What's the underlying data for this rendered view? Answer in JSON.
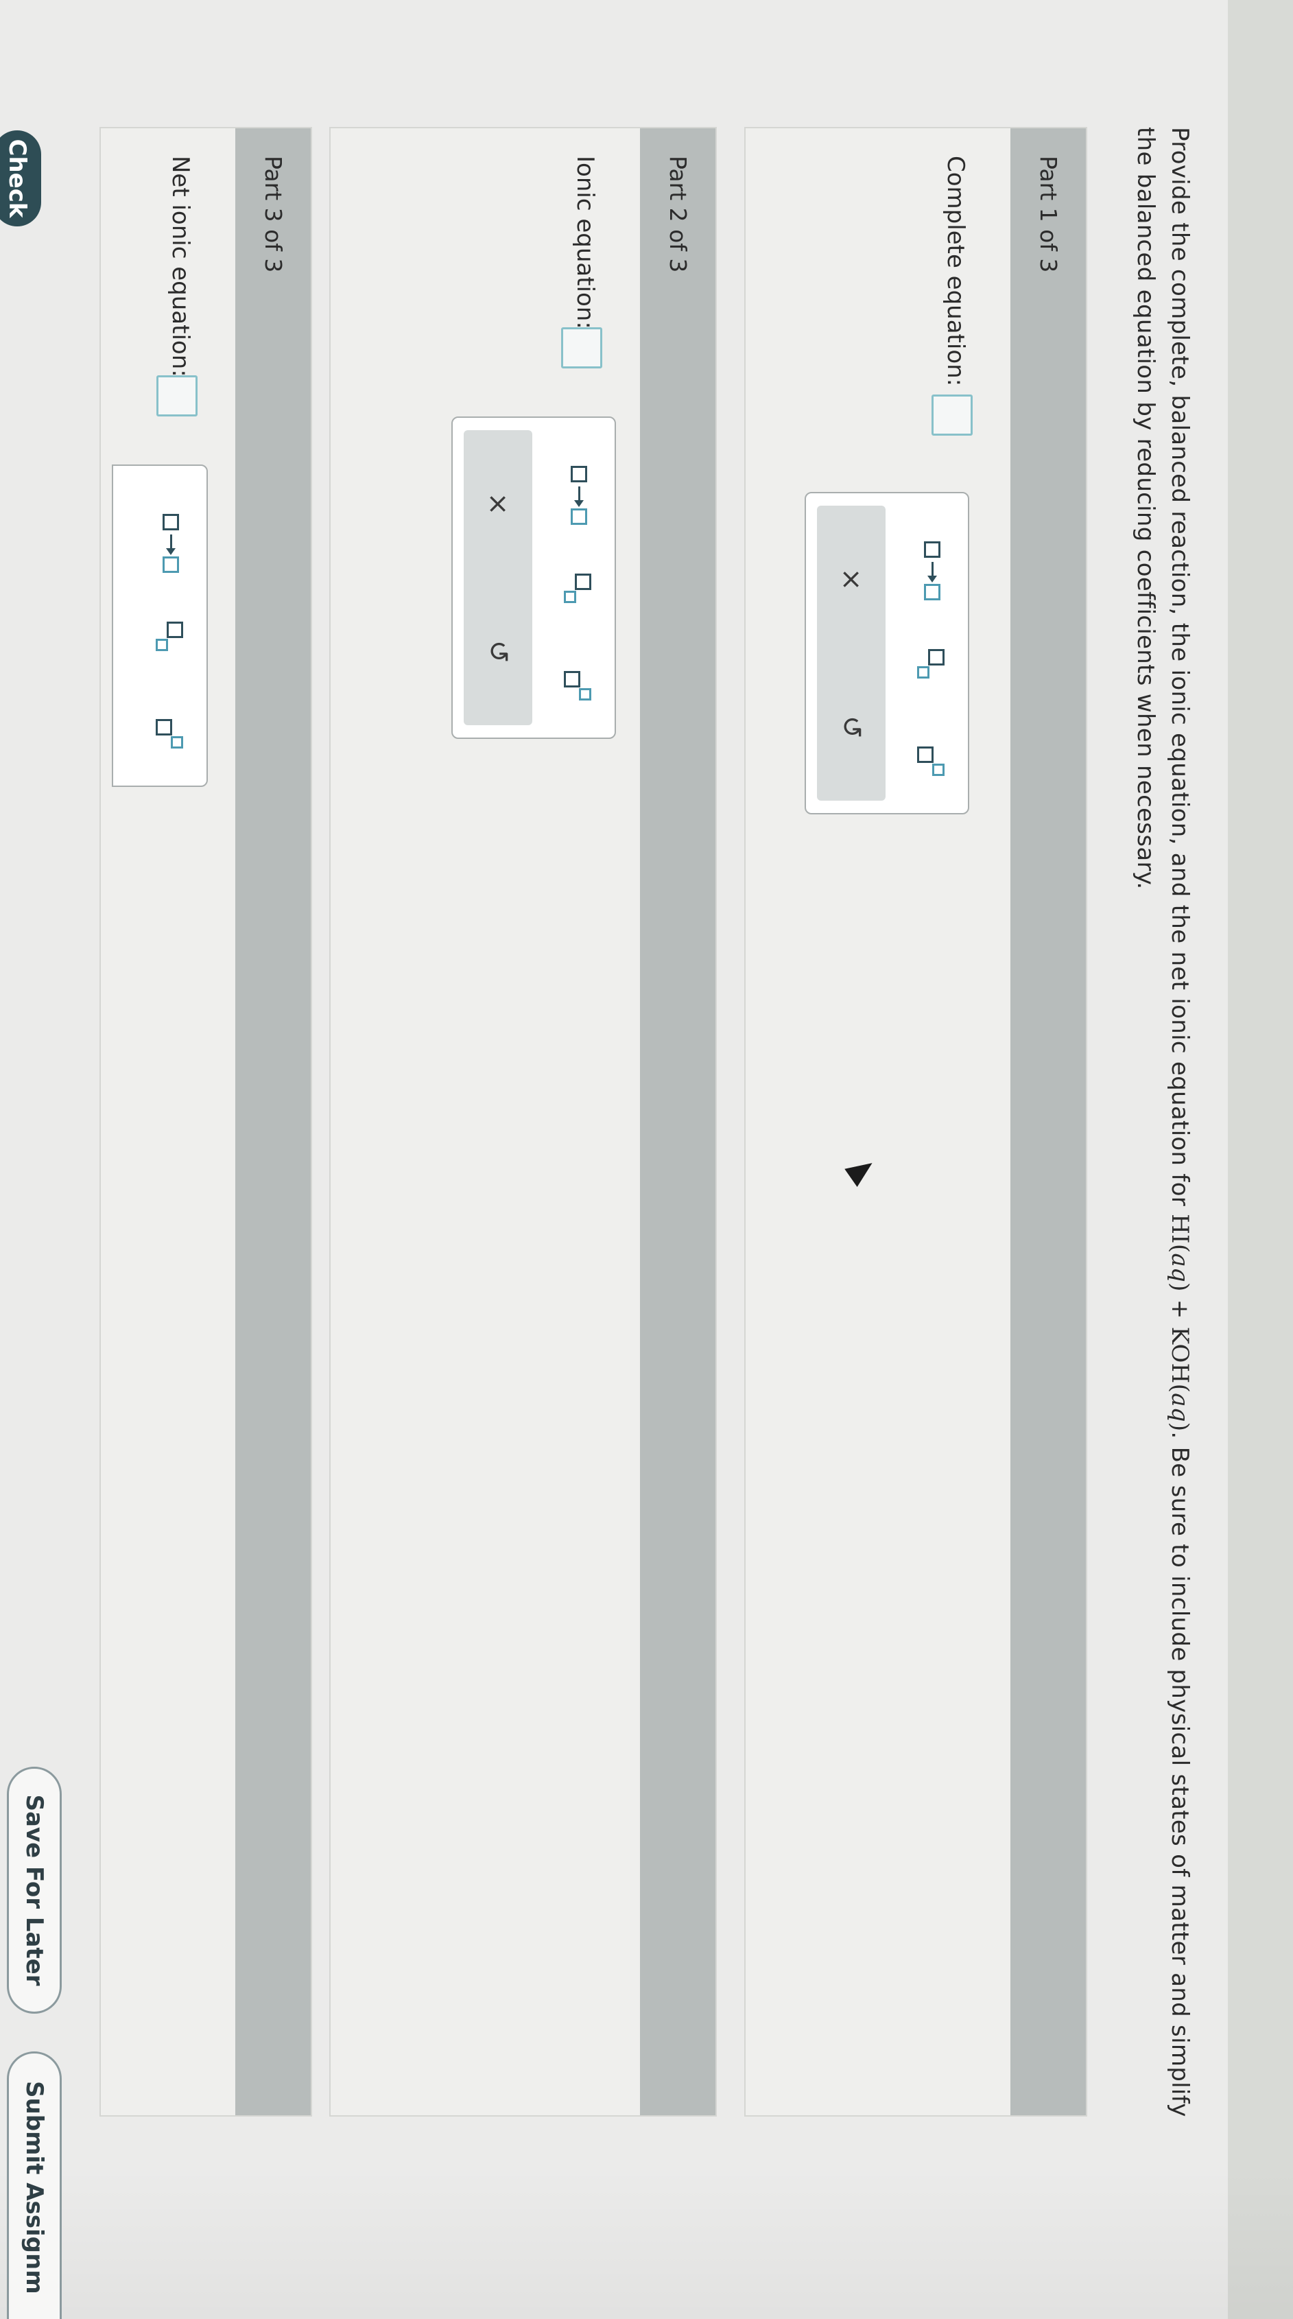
{
  "prompt": {
    "lead": "Provide the complete, balanced reaction, the ionic equation, and the net ionic equation for ",
    "r1_formula": "HI",
    "r1_state": "aq",
    "plus": "+",
    "r2_formula": "KOH",
    "r2_state": "aq",
    "rest": ". Be sure to include physical states of matter and simplify the balanced equation by reducing coefficients when necessary."
  },
  "parts": [
    {
      "header": "Part 1 of 3",
      "label": "Complete equation:"
    },
    {
      "header": "Part 2 of 3",
      "label": "Ionic equation:"
    },
    {
      "header": "Part 3 of 3",
      "label": "Net ionic equation:"
    }
  ],
  "palette": {
    "tools": [
      "reaction-arrow-icon",
      "subscript-icon",
      "superscript-icon"
    ],
    "clear_symbol": "×",
    "undo_symbol": "↺"
  },
  "footer": {
    "check": "Check",
    "save": "Save For Later",
    "submit": "Submit Assignm"
  }
}
